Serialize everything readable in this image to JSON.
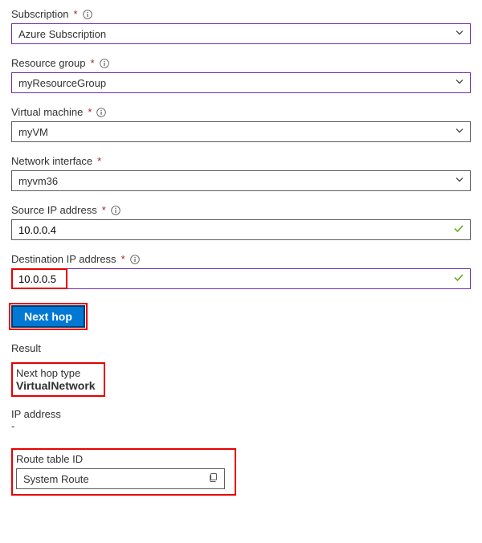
{
  "subscription": {
    "label": "Subscription",
    "value": "Azure Subscription"
  },
  "resource_group": {
    "label": "Resource group",
    "value": "myResourceGroup"
  },
  "virtual_machine": {
    "label": "Virtual machine",
    "value": "myVM"
  },
  "network_interface": {
    "label": "Network interface",
    "value": "myvm36"
  },
  "source_ip": {
    "label": "Source IP address",
    "value": "10.0.0.4"
  },
  "destination_ip": {
    "label": "Destination IP address",
    "value": "10.0.0.5"
  },
  "button": {
    "next_hop": "Next hop"
  },
  "result": {
    "title": "Result",
    "next_hop_type_label": "Next hop type",
    "next_hop_type_value": "VirtualNetwork",
    "ip_address_label": "IP address",
    "ip_address_value": "-",
    "route_table_label": "Route table ID",
    "route_table_value": "System Route"
  }
}
